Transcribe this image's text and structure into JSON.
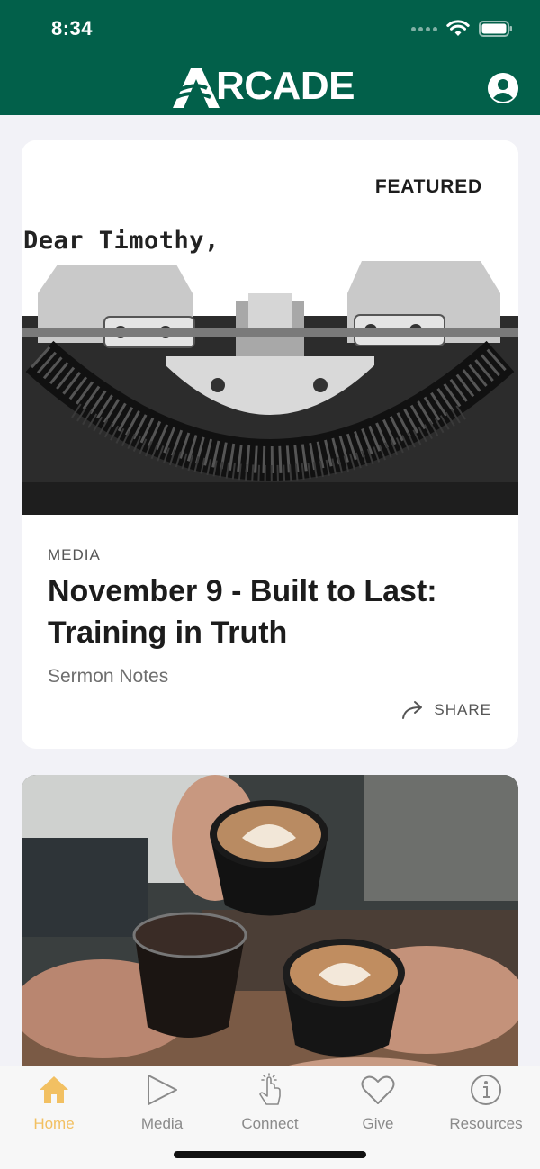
{
  "status_bar": {
    "time": "8:34"
  },
  "header": {
    "logo_text": "RCADE",
    "brand_color": "#02604a",
    "profile_icon": "person-icon"
  },
  "featured_card": {
    "badge": "FEATURED",
    "image_text": "Dear Timothy,",
    "category": "MEDIA",
    "title": "November 9 - Built to Last: Training in Truth",
    "subtitle": "Sermon Notes",
    "share_label": "SHARE",
    "share_icon": "share-arrow-icon"
  },
  "second_card": {
    "image": "coffee-cups-photo"
  },
  "tabbar": {
    "active_color": "#f2c062",
    "tabs": [
      {
        "label": "Home",
        "icon": "home-icon",
        "active": true
      },
      {
        "label": "Media",
        "icon": "play-icon",
        "active": false
      },
      {
        "label": "Connect",
        "icon": "tap-hand-icon",
        "active": false
      },
      {
        "label": "Give",
        "icon": "heart-icon",
        "active": false
      },
      {
        "label": "Resources",
        "icon": "info-icon",
        "active": false
      }
    ]
  }
}
